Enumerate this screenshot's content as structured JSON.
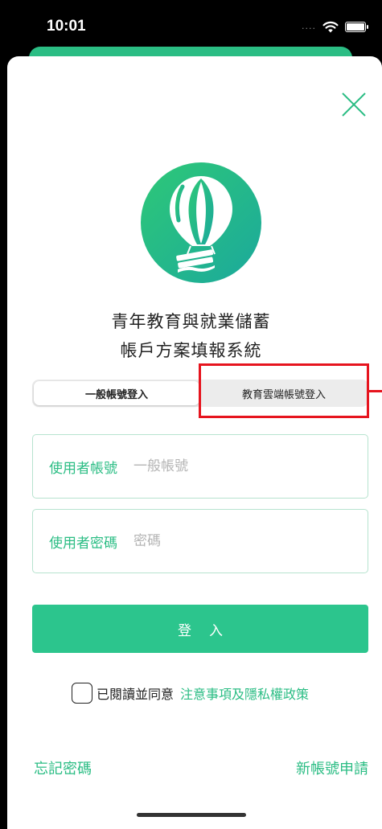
{
  "status_bar": {
    "time": "10:01",
    "signal_dots": "....",
    "wifi_icon": "wifi-icon",
    "battery_icon": "battery-icon"
  },
  "close_icon": "close-icon",
  "logo": {
    "icon": "hot-air-balloon-logo",
    "gradient_from": "#2ec877",
    "gradient_to": "#1ba99c"
  },
  "app_title": {
    "line1": "青年教育與就業儲蓄",
    "line2": "帳戶方案填報系統"
  },
  "tabs": [
    {
      "label": "一般帳號登入",
      "selected": true
    },
    {
      "label": "教育雲端帳號登入",
      "selected": false
    }
  ],
  "form": {
    "username": {
      "label": "使用者帳號",
      "placeholder": "一般帳號",
      "value": ""
    },
    "password": {
      "label": "使用者密碼",
      "placeholder": "密碼",
      "value": ""
    }
  },
  "login_button": "登入",
  "agreement": {
    "text": "已閱讀並同意",
    "link": "注意事項及隱私權政策",
    "checked": false
  },
  "footer": {
    "forgot": "忘記密碼",
    "register": "新帳號申請"
  },
  "colors": {
    "accent": "#2bbd84",
    "button": "#2cc58d",
    "highlight": "#e6141e"
  }
}
